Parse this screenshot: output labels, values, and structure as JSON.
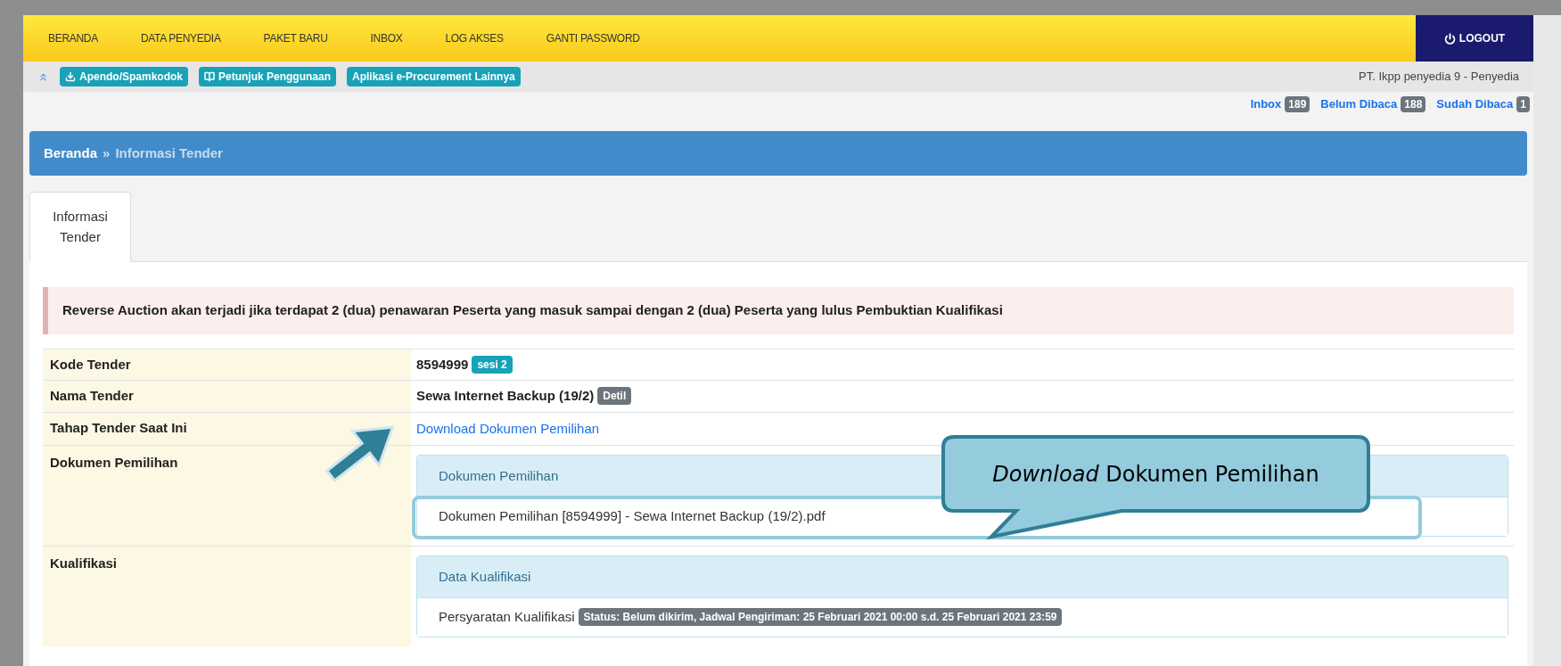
{
  "nav": {
    "items": [
      "BERANDA",
      "DATA PENYEDIA",
      "PAKET BARU",
      "INBOX",
      "LOG AKSES",
      "GANTI PASSWORD"
    ],
    "logout": "LOGOUT"
  },
  "subbar": {
    "links": [
      {
        "label": "Apendo/Spamkodok",
        "kind": "download"
      },
      {
        "label": "Petunjuk Penggunaan",
        "kind": "book"
      },
      {
        "label": "Aplikasi e-Procurement Lainnya",
        "kind": "plain"
      }
    ],
    "user": "PT. Ikpp penyedia 9 - Penyedia"
  },
  "mail_counts": [
    {
      "label": "Inbox",
      "count": "189"
    },
    {
      "label": "Belum Dibaca",
      "count": "188"
    },
    {
      "label": "Sudah Dibaca",
      "count": "1"
    }
  ],
  "breadcrumb": {
    "home": "Beranda",
    "separator": "»",
    "current": "Informasi Tender"
  },
  "tabs": [
    {
      "label": "Informasi Tender",
      "selected": true
    }
  ],
  "alert": "Reverse Auction akan terjadi jika terdapat 2 (dua) penawaran Peserta yang masuk sampai dengan 2 (dua) Peserta yang lulus Pembuktian Kualifikasi",
  "table": {
    "rows": [
      {
        "label": "Kode Tender",
        "kind": "text",
        "value": "8594999",
        "badge": {
          "text": "sesi 2",
          "color": "#17a2b8"
        }
      },
      {
        "label": "Nama Tender",
        "kind": "text",
        "value": "Sewa Internet Backup (19/2)",
        "badge": {
          "text": "Detil",
          "color": "#6c757d"
        }
      },
      {
        "label": "Tahap Tender Saat Ini",
        "kind": "link",
        "value": "Download Dokumen Pemilihan"
      },
      {
        "label": "Dokumen Pemilihan",
        "kind": "panel",
        "panel_title": "Dokumen Pemilihan",
        "items": [
          {
            "text": "Dokumen Pemilihan [8594999] - Sewa Internet Backup (19/2).pdf",
            "highlighted": true
          }
        ]
      },
      {
        "label": "Kualifikasi",
        "kind": "panel",
        "panel_title": "Data Kualifikasi",
        "items": [
          {
            "text": "Persyaratan Kualifikasi",
            "badge": "Status: Belum dikirim, Jadwal Pengiriman: 25 Februari 2021 00:00 s.d. 25 Februari 2021 23:59",
            "highlighted": false
          }
        ]
      }
    ]
  },
  "callout": {
    "text": "*Download* Dokumen Pemilihan"
  }
}
